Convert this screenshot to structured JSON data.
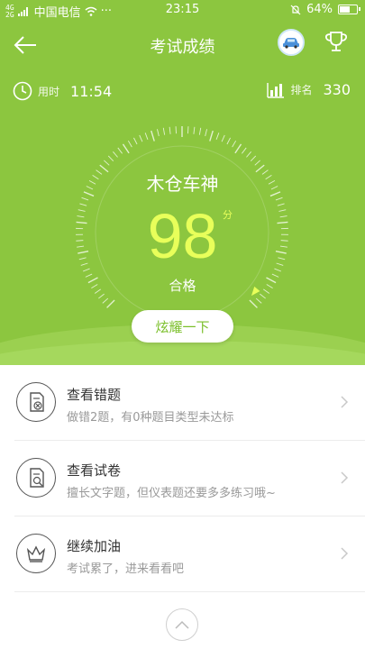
{
  "status_bar": {
    "signal_top": "4G",
    "signal_bottom": "2G",
    "carrier": "中国电信",
    "dots": "···",
    "time": "23:15",
    "battery_text": "64%",
    "battery_level": 0.64
  },
  "nav": {
    "title": "考试成绩",
    "back_icon": "arrow-left-icon",
    "car_icon": "car-icon",
    "trophy_icon": "trophy-icon"
  },
  "stats": {
    "time_label": "用时",
    "time_value": "11:54",
    "rank_label": "排名",
    "rank_value": "330"
  },
  "result": {
    "name": "木仓车神",
    "score": "98",
    "unit": "分",
    "verdict": "合格",
    "share_label": "炫耀一下",
    "score_fraction": 0.98
  },
  "list": [
    {
      "title": "查看错题",
      "subtitle": "做错2题，有0种题目类型未达标",
      "icon": "wrong-paper-icon"
    },
    {
      "title": "查看试卷",
      "subtitle": "擅长文字题，但仪表题还要多多练习哦~",
      "icon": "search-paper-icon"
    },
    {
      "title": "继续加油",
      "subtitle": "考试累了，进来看看吧",
      "icon": "crown-icon"
    }
  ],
  "colors": {
    "primary": "#8cc63f",
    "score": "#e8ff5a",
    "share_text": "#7bbf2a"
  }
}
